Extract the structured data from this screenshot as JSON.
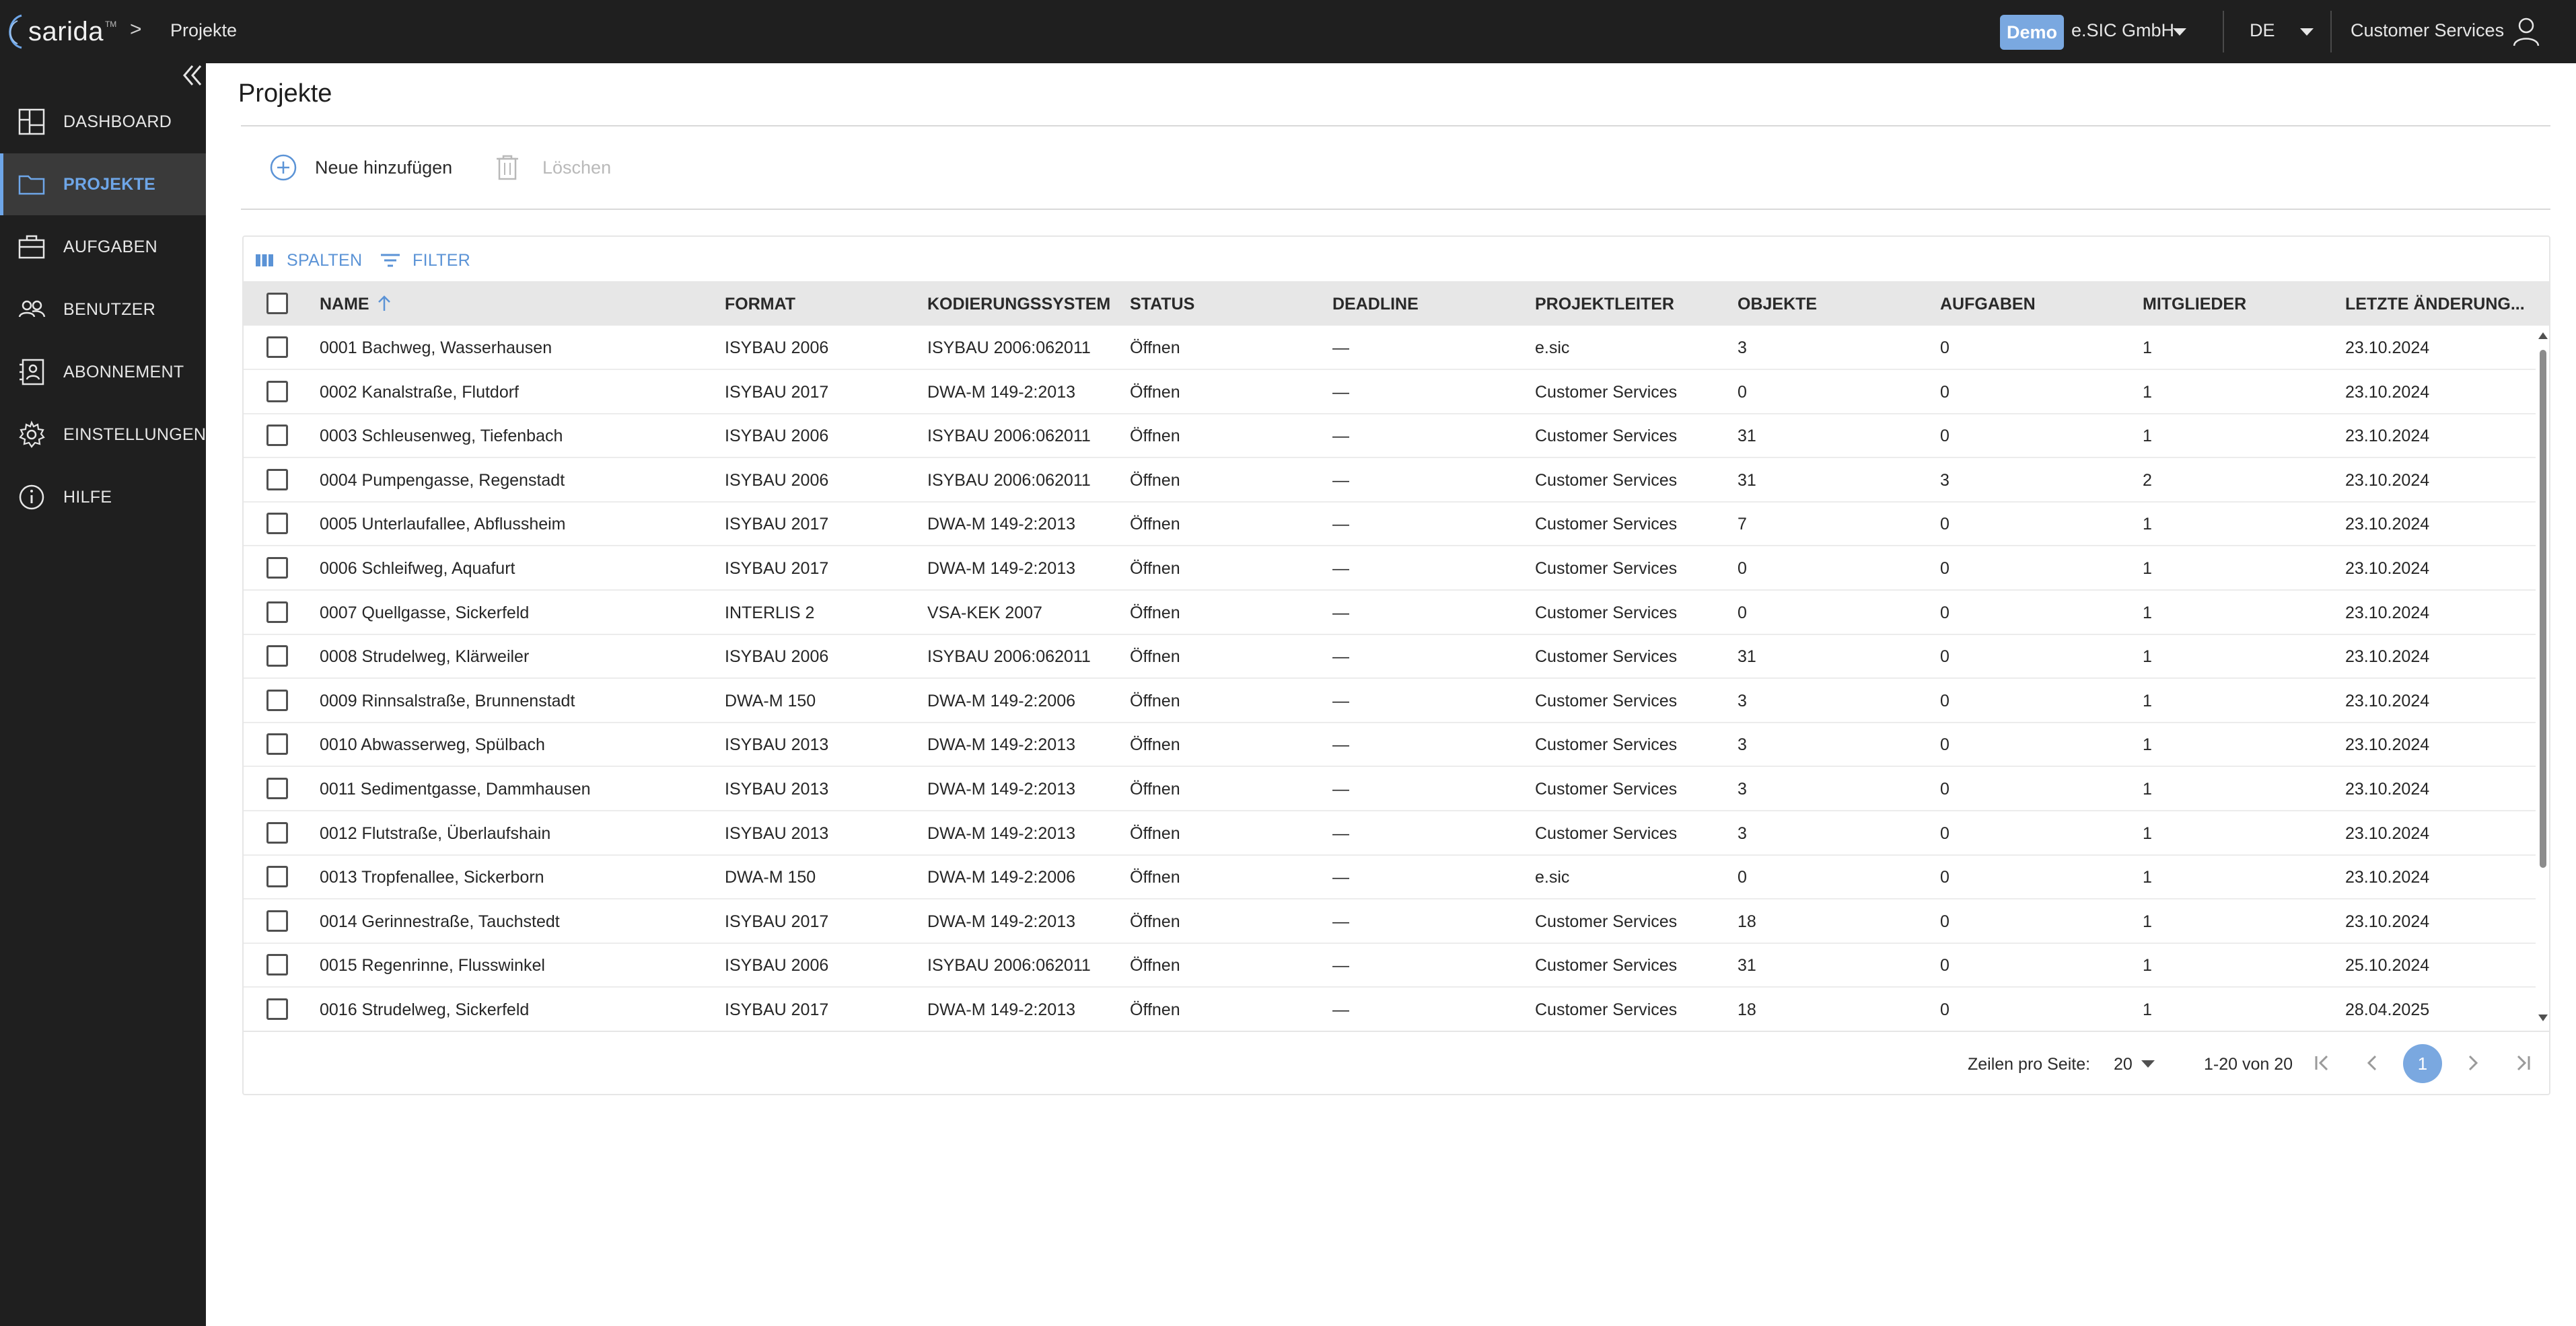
{
  "app": {
    "logo_text": "sarida",
    "logo_tm": "TM",
    "breadcrumb_sep": ">",
    "breadcrumb": "Projekte",
    "demo_badge": "Demo",
    "company": "e.SIC GmbH",
    "language": "DE",
    "user": "Customer Services"
  },
  "sidebar": {
    "items": [
      {
        "label": "DASHBOARD",
        "icon": "dashboard-icon",
        "active": false
      },
      {
        "label": "PROJEKTE",
        "icon": "folder-icon",
        "active": true
      },
      {
        "label": "AUFGABEN",
        "icon": "briefcase-icon",
        "active": false
      },
      {
        "label": "BENUTZER",
        "icon": "users-icon",
        "active": false
      },
      {
        "label": "ABONNEMENT",
        "icon": "subscription-icon",
        "active": false
      },
      {
        "label": "EINSTELLUNGEN",
        "icon": "gear-icon",
        "active": false
      },
      {
        "label": "HILFE",
        "icon": "info-icon",
        "active": false
      }
    ]
  },
  "page": {
    "title": "Projekte",
    "add_label": "Neue hinzufügen",
    "delete_label": "Löschen"
  },
  "grid": {
    "columns_btn": "SPALTEN",
    "filter_btn": "FILTER",
    "headers": [
      "NAME",
      "FORMAT",
      "KODIERUNGSSYSTEM",
      "STATUS",
      "DEADLINE",
      "PROJEKTLEITER",
      "OBJEKTE",
      "AUFGABEN",
      "MITGLIEDER",
      "LETZTE ÄNDERUNG..."
    ],
    "rows": [
      [
        "0001 Bachweg, Wasserhausen",
        "ISYBAU 2006",
        "ISYBAU 2006:062011",
        "Öffnen",
        "—",
        "e.sic",
        "3",
        "0",
        "1",
        "23.10.2024"
      ],
      [
        "0002 Kanalstraße, Flutdorf",
        "ISYBAU 2017",
        "DWA-M 149-2:2013",
        "Öffnen",
        "—",
        "Customer Services",
        "0",
        "0",
        "1",
        "23.10.2024"
      ],
      [
        "0003 Schleusenweg, Tiefenbach",
        "ISYBAU 2006",
        "ISYBAU 2006:062011",
        "Öffnen",
        "—",
        "Customer Services",
        "31",
        "0",
        "1",
        "23.10.2024"
      ],
      [
        "0004 Pumpengasse, Regenstadt",
        "ISYBAU 2006",
        "ISYBAU 2006:062011",
        "Öffnen",
        "—",
        "Customer Services",
        "31",
        "3",
        "2",
        "23.10.2024"
      ],
      [
        "0005 Unterlaufallee, Abflussheim",
        "ISYBAU 2017",
        "DWA-M 149-2:2013",
        "Öffnen",
        "—",
        "Customer Services",
        "7",
        "0",
        "1",
        "23.10.2024"
      ],
      [
        "0006 Schleifweg, Aquafurt",
        "ISYBAU 2017",
        "DWA-M 149-2:2013",
        "Öffnen",
        "—",
        "Customer Services",
        "0",
        "0",
        "1",
        "23.10.2024"
      ],
      [
        "0007 Quellgasse, Sickerfeld",
        "INTERLIS 2",
        "VSA-KEK 2007",
        "Öffnen",
        "—",
        "Customer Services",
        "0",
        "0",
        "1",
        "23.10.2024"
      ],
      [
        "0008 Strudelweg, Klärweiler",
        "ISYBAU 2006",
        "ISYBAU 2006:062011",
        "Öffnen",
        "—",
        "Customer Services",
        "31",
        "0",
        "1",
        "23.10.2024"
      ],
      [
        "0009 Rinnsalstraße, Brunnenstadt",
        "DWA-M 150",
        "DWA-M 149-2:2006",
        "Öffnen",
        "—",
        "Customer Services",
        "3",
        "0",
        "1",
        "23.10.2024"
      ],
      [
        "0010 Abwasserweg, Spülbach",
        "ISYBAU 2013",
        "DWA-M 149-2:2013",
        "Öffnen",
        "—",
        "Customer Services",
        "3",
        "0",
        "1",
        "23.10.2024"
      ],
      [
        "0011 Sedimentgasse, Dammhausen",
        "ISYBAU 2013",
        "DWA-M 149-2:2013",
        "Öffnen",
        "—",
        "Customer Services",
        "3",
        "0",
        "1",
        "23.10.2024"
      ],
      [
        "0012 Flutstraße, Überlaufshain",
        "ISYBAU 2013",
        "DWA-M 149-2:2013",
        "Öffnen",
        "—",
        "Customer Services",
        "3",
        "0",
        "1",
        "23.10.2024"
      ],
      [
        "0013 Tropfenallee, Sickerborn",
        "DWA-M 150",
        "DWA-M 149-2:2006",
        "Öffnen",
        "—",
        "e.sic",
        "0",
        "0",
        "1",
        "23.10.2024"
      ],
      [
        "0014 Gerinnestraße, Tauchstedt",
        "ISYBAU 2017",
        "DWA-M 149-2:2013",
        "Öffnen",
        "—",
        "Customer Services",
        "18",
        "0",
        "1",
        "23.10.2024"
      ],
      [
        "0015 Regenrinne, Flusswinkel",
        "ISYBAU 2006",
        "ISYBAU 2006:062011",
        "Öffnen",
        "—",
        "Customer Services",
        "31",
        "0",
        "1",
        "25.10.2024"
      ],
      [
        "0016 Strudelweg, Sickerfeld",
        "ISYBAU 2017",
        "DWA-M 149-2:2013",
        "Öffnen",
        "—",
        "Customer Services",
        "18",
        "0",
        "1",
        "28.04.2025"
      ]
    ]
  },
  "pagination": {
    "rows_per_page_label": "Zeilen pro Seite:",
    "rows_per_page": "20",
    "range": "1-20 von 20",
    "current_page": "1"
  },
  "colors": {
    "topbar": "#1f1f1f",
    "accent": "#6ea6e8",
    "badge": "#7aa8e0"
  }
}
